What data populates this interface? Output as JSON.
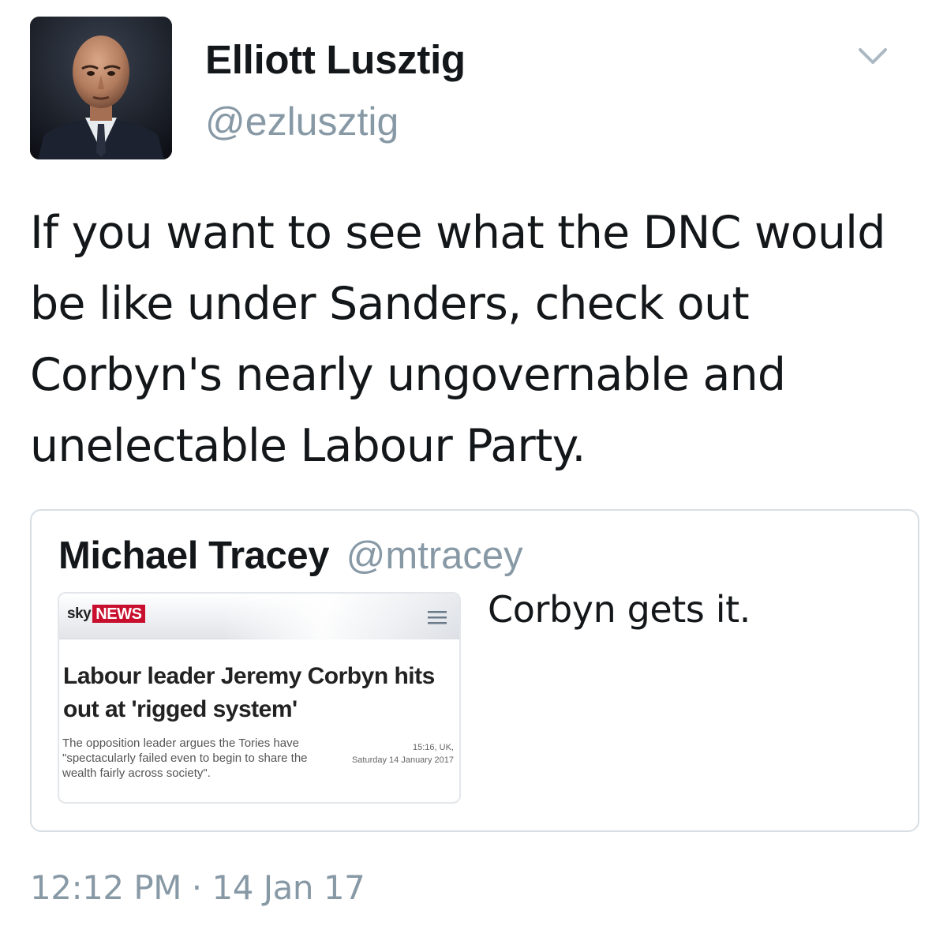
{
  "tweet": {
    "author": {
      "display_name": "Elliott Lusztig",
      "handle": "@ezlusztig",
      "avatar_icon": "profile-photo"
    },
    "text": "If you want to see what the DNC would be like under Sanders, check out Corbyn's nearly ungovernable and unelectable Labour Party.",
    "timestamp": "12:12 PM · 14 Jan 17",
    "menu_icon": "chevron-down-icon"
  },
  "quoted_tweet": {
    "display_name": "Michael Tracey",
    "handle": "@mtracey",
    "text": "Corbyn gets it.",
    "image": {
      "logo_sky": "sky",
      "logo_news": "NEWS",
      "headline": "Labour leader Jeremy Corbyn hits out at 'rigged system'",
      "summary": "The opposition leader argues the Tories have \"spectacularly failed even to begin to share the wealth fairly across society\".",
      "time_line1": "15:16, UK,",
      "time_line2": "Saturday 14 January 2017",
      "menu_icon": "hamburger-menu-icon"
    }
  },
  "colors": {
    "text": "#14171a",
    "secondary": "#8899a6",
    "border": "#d7dfe5",
    "sky_red": "#c8102e"
  }
}
